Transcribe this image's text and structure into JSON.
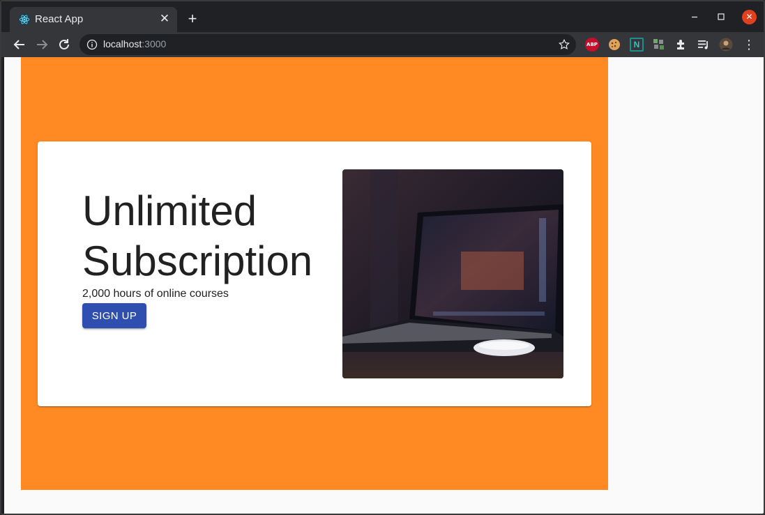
{
  "browser": {
    "tab": {
      "title": "React App",
      "favicon": "react-logo-icon",
      "close_glyph": "✕"
    },
    "new_tab_glyph": "+",
    "window_controls": {
      "close_glyph": "✕"
    },
    "address": {
      "host": "localhost",
      "port": ":3000"
    },
    "extensions": {
      "abp_label": "ABP",
      "n_label": "N"
    }
  },
  "page": {
    "headline": "Unlimited Subscription",
    "subtitle": "2,000 hours of online courses",
    "cta_label": "SIGN UP",
    "image_subject": "laptop-photo"
  },
  "colors": {
    "hero_background": "#ff8922",
    "card_background": "#ffffff",
    "button": "#2f4fb0",
    "browser_frame": "#202124",
    "toolbar": "#35363a"
  }
}
